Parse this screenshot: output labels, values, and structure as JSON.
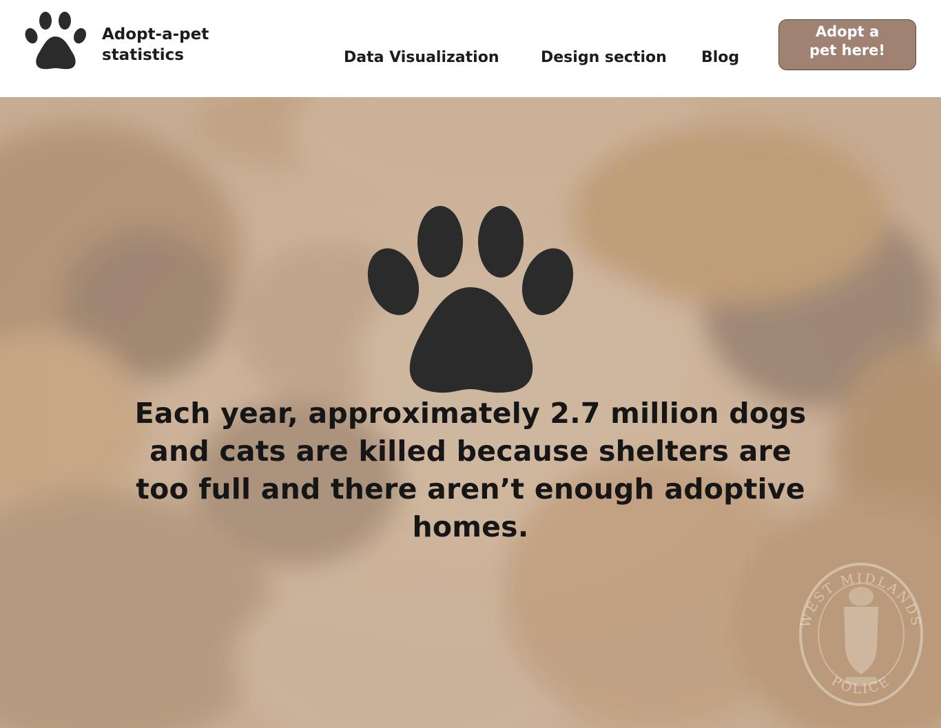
{
  "header": {
    "brand_line1": "Adopt-a-pet",
    "brand_line2": "statistics",
    "logo_icon": "paw-print-icon",
    "nav": [
      {
        "label": "Data Visualization"
      },
      {
        "label": "Design section"
      },
      {
        "label": "Blog"
      }
    ],
    "cta_line1": "Adopt a",
    "cta_line2": "pet here!"
  },
  "hero": {
    "background": "photo of sleeping German Shepherd puppies (washed out)",
    "icon": "paw-print-icon",
    "statement": "Each year, approximately 2.7 million dogs and cats are killed because shelters are too full and there aren’t enough adoptive homes.",
    "watermark_text_top": "WEST MIDLANDS",
    "watermark_text_bottom": "POLICE"
  },
  "colors": {
    "cta_background": "#a08272",
    "text": "#1c1c1c",
    "paw": "#2b2b2b",
    "hero_tint": "#c6a98c"
  }
}
